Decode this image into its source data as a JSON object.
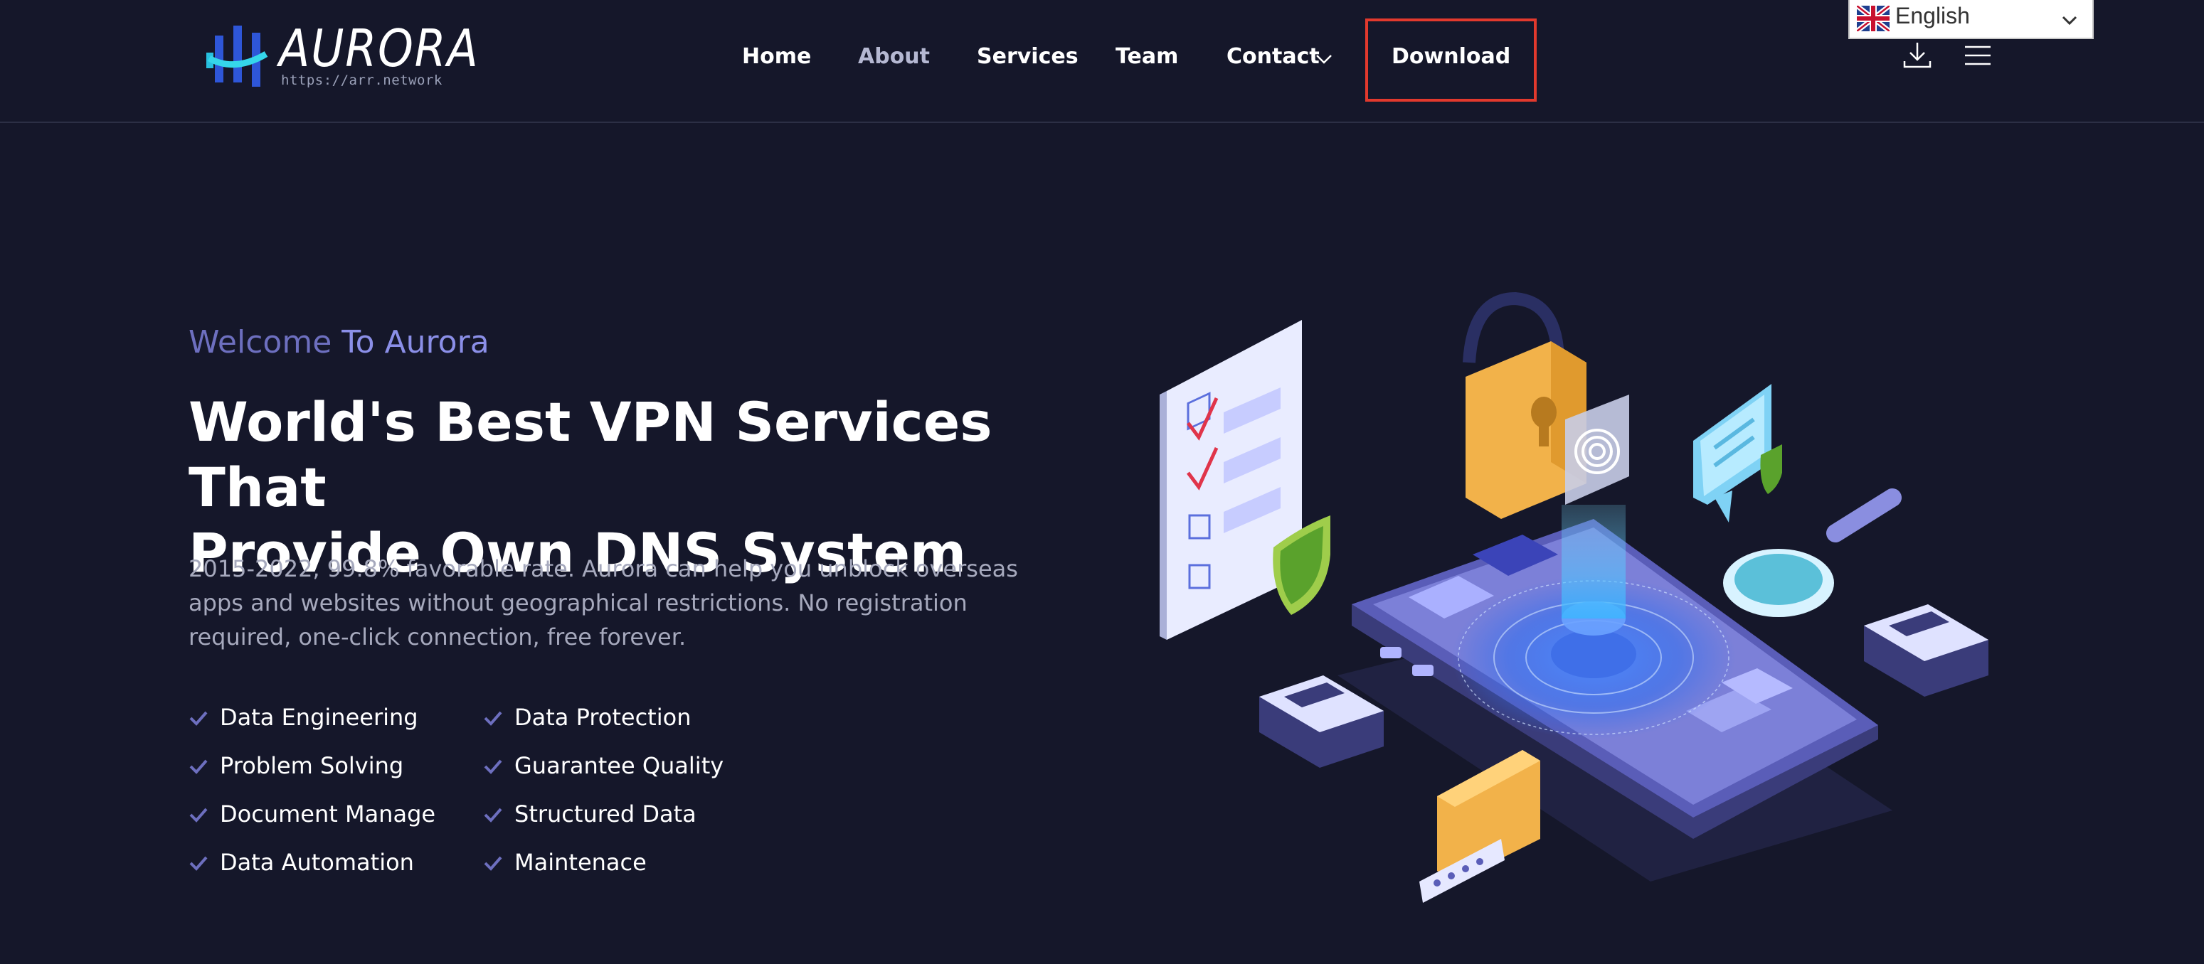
{
  "brand": {
    "name": "AURORA",
    "url": "https://arr.network"
  },
  "nav": {
    "items": [
      "Home",
      "About",
      "Services",
      "Team",
      "Contact",
      "Download"
    ],
    "highlighted": "Download"
  },
  "header_icons": [
    "download-icon",
    "menu-icon"
  ],
  "language": {
    "selected": "English",
    "flag": "uk-flag-icon"
  },
  "hero": {
    "eyebrow_lead": "Welcome",
    "eyebrow_accent": "To Aurora",
    "headline_line1": "World's Best VPN Services That",
    "headline_line2": "Provide Own DNS System",
    "description": "2015-2022,  99.8% favorable rate. Aurora can help you unblock overseas apps and websites without geographical restrictions. No registration required, one-click connection, free forever.",
    "features_col1": [
      "Data Engineering",
      "Problem Solving",
      "Document Manage",
      "Data Automation"
    ],
    "features_col2": [
      "Data Protection",
      "Guarantee Quality",
      "Structured Data",
      "Maintenace"
    ]
  },
  "colors": {
    "background": "#15172a",
    "accent": "#8b8fe8",
    "highlight_border": "#e2392d",
    "check": "#6d6fbf"
  }
}
